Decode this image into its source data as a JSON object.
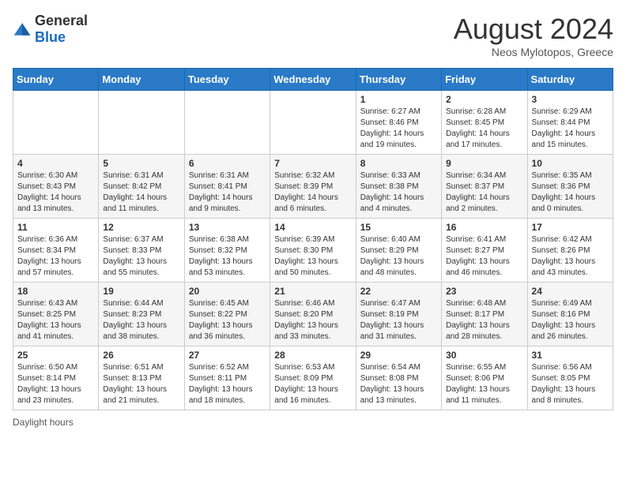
{
  "logo": {
    "general": "General",
    "blue": "Blue"
  },
  "title": "August 2024",
  "location": "Neos Mylotopos, Greece",
  "days_of_week": [
    "Sunday",
    "Monday",
    "Tuesday",
    "Wednesday",
    "Thursday",
    "Friday",
    "Saturday"
  ],
  "weeks": [
    [
      {
        "day": "",
        "info": ""
      },
      {
        "day": "",
        "info": ""
      },
      {
        "day": "",
        "info": ""
      },
      {
        "day": "",
        "info": ""
      },
      {
        "day": "1",
        "info": "Sunrise: 6:27 AM\nSunset: 8:46 PM\nDaylight: 14 hours and 19 minutes."
      },
      {
        "day": "2",
        "info": "Sunrise: 6:28 AM\nSunset: 8:45 PM\nDaylight: 14 hours and 17 minutes."
      },
      {
        "day": "3",
        "info": "Sunrise: 6:29 AM\nSunset: 8:44 PM\nDaylight: 14 hours and 15 minutes."
      }
    ],
    [
      {
        "day": "4",
        "info": "Sunrise: 6:30 AM\nSunset: 8:43 PM\nDaylight: 14 hours and 13 minutes."
      },
      {
        "day": "5",
        "info": "Sunrise: 6:31 AM\nSunset: 8:42 PM\nDaylight: 14 hours and 11 minutes."
      },
      {
        "day": "6",
        "info": "Sunrise: 6:31 AM\nSunset: 8:41 PM\nDaylight: 14 hours and 9 minutes."
      },
      {
        "day": "7",
        "info": "Sunrise: 6:32 AM\nSunset: 8:39 PM\nDaylight: 14 hours and 6 minutes."
      },
      {
        "day": "8",
        "info": "Sunrise: 6:33 AM\nSunset: 8:38 PM\nDaylight: 14 hours and 4 minutes."
      },
      {
        "day": "9",
        "info": "Sunrise: 6:34 AM\nSunset: 8:37 PM\nDaylight: 14 hours and 2 minutes."
      },
      {
        "day": "10",
        "info": "Sunrise: 6:35 AM\nSunset: 8:36 PM\nDaylight: 14 hours and 0 minutes."
      }
    ],
    [
      {
        "day": "11",
        "info": "Sunrise: 6:36 AM\nSunset: 8:34 PM\nDaylight: 13 hours and 57 minutes."
      },
      {
        "day": "12",
        "info": "Sunrise: 6:37 AM\nSunset: 8:33 PM\nDaylight: 13 hours and 55 minutes."
      },
      {
        "day": "13",
        "info": "Sunrise: 6:38 AM\nSunset: 8:32 PM\nDaylight: 13 hours and 53 minutes."
      },
      {
        "day": "14",
        "info": "Sunrise: 6:39 AM\nSunset: 8:30 PM\nDaylight: 13 hours and 50 minutes."
      },
      {
        "day": "15",
        "info": "Sunrise: 6:40 AM\nSunset: 8:29 PM\nDaylight: 13 hours and 48 minutes."
      },
      {
        "day": "16",
        "info": "Sunrise: 6:41 AM\nSunset: 8:27 PM\nDaylight: 13 hours and 46 minutes."
      },
      {
        "day": "17",
        "info": "Sunrise: 6:42 AM\nSunset: 8:26 PM\nDaylight: 13 hours and 43 minutes."
      }
    ],
    [
      {
        "day": "18",
        "info": "Sunrise: 6:43 AM\nSunset: 8:25 PM\nDaylight: 13 hours and 41 minutes."
      },
      {
        "day": "19",
        "info": "Sunrise: 6:44 AM\nSunset: 8:23 PM\nDaylight: 13 hours and 38 minutes."
      },
      {
        "day": "20",
        "info": "Sunrise: 6:45 AM\nSunset: 8:22 PM\nDaylight: 13 hours and 36 minutes."
      },
      {
        "day": "21",
        "info": "Sunrise: 6:46 AM\nSunset: 8:20 PM\nDaylight: 13 hours and 33 minutes."
      },
      {
        "day": "22",
        "info": "Sunrise: 6:47 AM\nSunset: 8:19 PM\nDaylight: 13 hours and 31 minutes."
      },
      {
        "day": "23",
        "info": "Sunrise: 6:48 AM\nSunset: 8:17 PM\nDaylight: 13 hours and 28 minutes."
      },
      {
        "day": "24",
        "info": "Sunrise: 6:49 AM\nSunset: 8:16 PM\nDaylight: 13 hours and 26 minutes."
      }
    ],
    [
      {
        "day": "25",
        "info": "Sunrise: 6:50 AM\nSunset: 8:14 PM\nDaylight: 13 hours and 23 minutes."
      },
      {
        "day": "26",
        "info": "Sunrise: 6:51 AM\nSunset: 8:13 PM\nDaylight: 13 hours and 21 minutes."
      },
      {
        "day": "27",
        "info": "Sunrise: 6:52 AM\nSunset: 8:11 PM\nDaylight: 13 hours and 18 minutes."
      },
      {
        "day": "28",
        "info": "Sunrise: 6:53 AM\nSunset: 8:09 PM\nDaylight: 13 hours and 16 minutes."
      },
      {
        "day": "29",
        "info": "Sunrise: 6:54 AM\nSunset: 8:08 PM\nDaylight: 13 hours and 13 minutes."
      },
      {
        "day": "30",
        "info": "Sunrise: 6:55 AM\nSunset: 8:06 PM\nDaylight: 13 hours and 11 minutes."
      },
      {
        "day": "31",
        "info": "Sunrise: 6:56 AM\nSunset: 8:05 PM\nDaylight: 13 hours and 8 minutes."
      }
    ]
  ],
  "footer": "Daylight hours"
}
